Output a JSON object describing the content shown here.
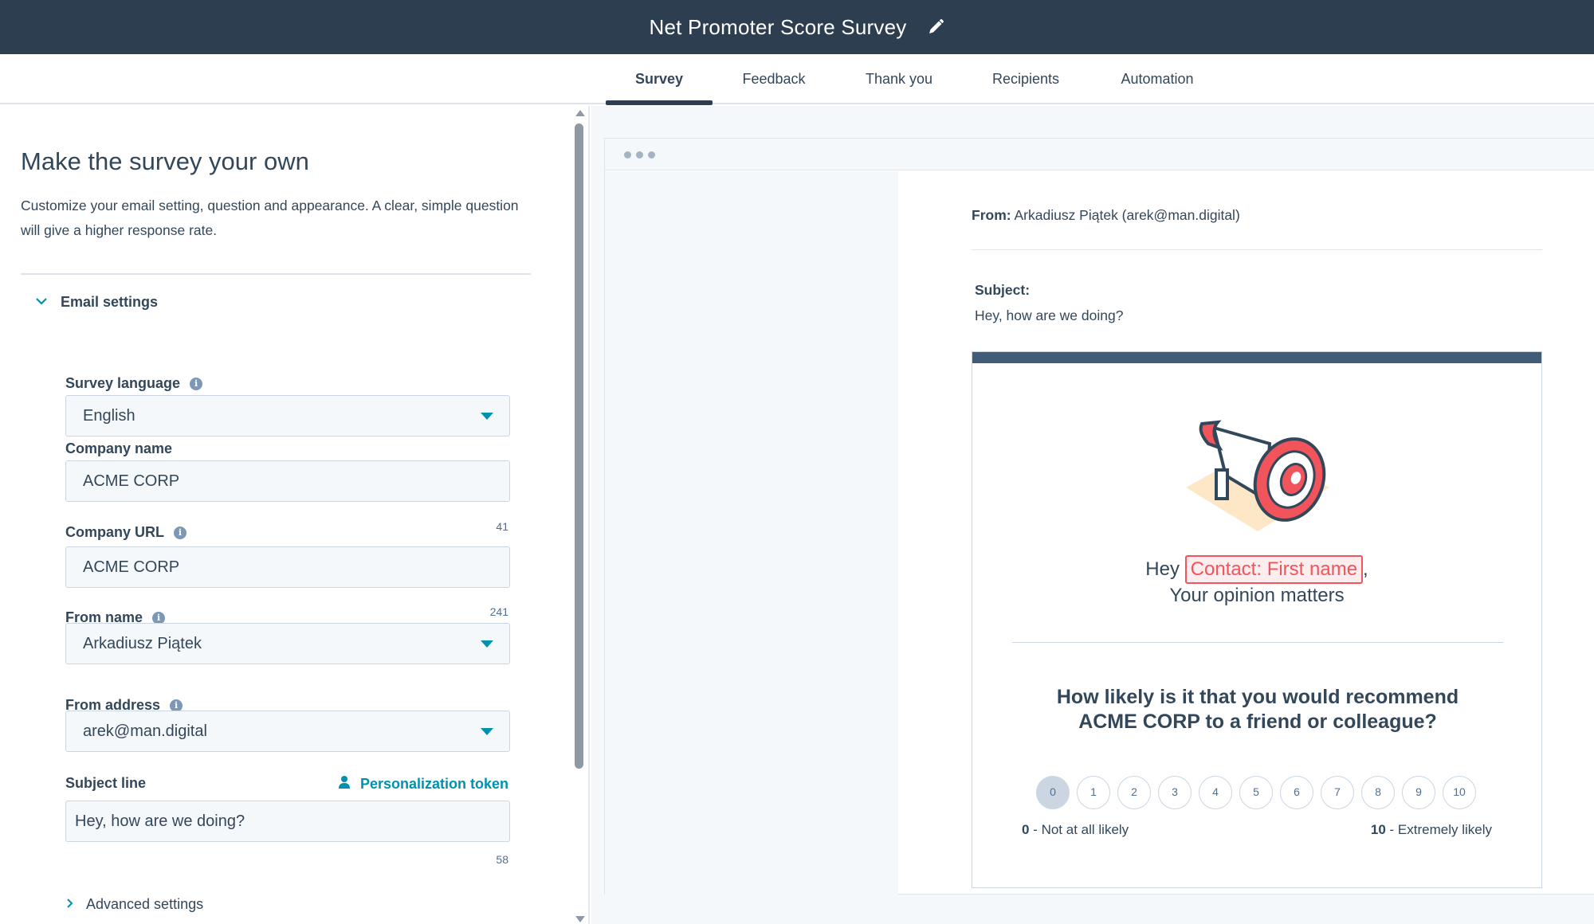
{
  "header": {
    "title": "Net Promoter Score Survey",
    "edit_icon": "pencil-icon"
  },
  "tabs": [
    {
      "label": "Survey",
      "active": true
    },
    {
      "label": "Feedback",
      "active": false
    },
    {
      "label": "Thank you",
      "active": false
    },
    {
      "label": "Recipients",
      "active": false
    },
    {
      "label": "Automation",
      "active": false
    }
  ],
  "left": {
    "heading": "Make the survey your own",
    "description": "Customize your email setting, question and appearance. A clear, simple question will give a higher response rate.",
    "section": {
      "label": "Email settings",
      "expanded": true
    },
    "fields": {
      "survey_language": {
        "label": "Survey language",
        "value": "English"
      },
      "company_name": {
        "label": "Company name",
        "value": "ACME CORP"
      },
      "company_url": {
        "label": "Company URL",
        "value": "ACME CORP",
        "counter": "41"
      },
      "from_name": {
        "label": "From name",
        "value": "Arkadiusz Piątek",
        "counter": "241"
      },
      "from_address": {
        "label": "From address",
        "value": "arek@man.digital"
      },
      "subject_line": {
        "label": "Subject line",
        "value": "Hey, how are we doing?",
        "counter": "58"
      }
    },
    "personalization_token": "Personalization token",
    "advanced_settings": "Advanced settings"
  },
  "preview": {
    "from_label": "From:",
    "from_value": "Arkadiusz Piątek (arek@man.digital)",
    "subject_label": "Subject:",
    "subject_value": "Hey, how are we doing?",
    "greeting_prefix": "Hey",
    "greeting_token": "Contact: First name",
    "greeting_suffix": ",",
    "greeting_line2": "Your opinion matters",
    "question": "How likely is it that you would recommend ACME CORP to a friend or colleague?",
    "scale": [
      "0",
      "1",
      "2",
      "3",
      "4",
      "5",
      "6",
      "7",
      "8",
      "9",
      "10"
    ],
    "scale_selected": "0",
    "low_num": "0",
    "low_text": " - Not at all likely",
    "high_num": "10",
    "high_text": " - Extremely likely"
  },
  "colors": {
    "header_bg": "#2d3e50",
    "accent_teal": "#0091ae",
    "token_red": "#f2545b",
    "card_top": "#425b76"
  }
}
